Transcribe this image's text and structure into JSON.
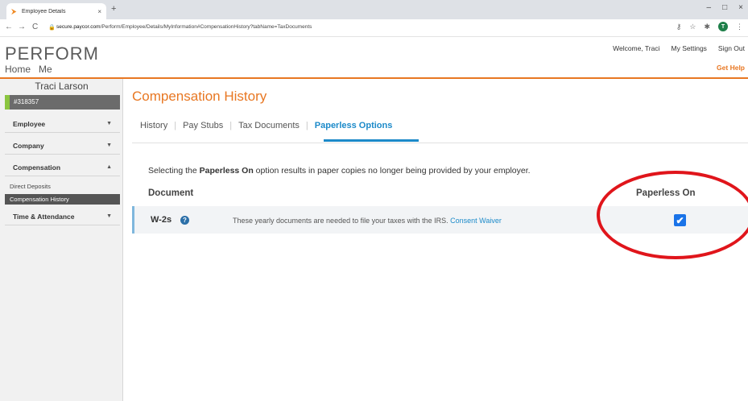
{
  "browser": {
    "tab_title": "Employee Details",
    "tab_close": "×",
    "new_tab": "+",
    "favicon": "⮞",
    "window_controls": [
      "–",
      "□",
      "×"
    ],
    "url_host": "secure.paycor.com",
    "url_path": "/Perform/Employee/Details/MyInformation#CompensationHistory?tabName=TaxDocuments",
    "profile_initial": "T"
  },
  "header": {
    "brand": "PERFORM",
    "nav": [
      "Home",
      "Me"
    ],
    "welcome": "Welcome, Traci",
    "my_settings": "My Settings",
    "sign_out": "Sign Out",
    "get_help": "Get Help",
    "accent_color": "#e87722"
  },
  "sidebar": {
    "employee_name": "Traci Larson",
    "employee_id": "#318357",
    "sections": [
      {
        "label": "Employee",
        "caret": "▼"
      },
      {
        "label": "Company",
        "caret": "▼"
      },
      {
        "label": "Compensation",
        "caret": "▲"
      },
      {
        "label": "Time & Attendance",
        "caret": "▼"
      }
    ],
    "sub_items": [
      "Direct Deposits",
      "Compensation History"
    ]
  },
  "main": {
    "title": "Compensation History",
    "tabs": [
      "History",
      "Pay Stubs",
      "Tax Documents",
      "Paperless Options"
    ],
    "active_tab": "Paperless Options",
    "intro_before": "Selecting the ",
    "intro_bold": "Paperless On",
    "intro_after": " option results in paper copies no longer being provided by your employer.",
    "col_document": "Document",
    "col_paperless": "Paperless On",
    "rows": [
      {
        "name": "W-2s",
        "help": "?",
        "description": "These yearly documents are needed to file your taxes with the IRS.",
        "link": "Consent Waiver",
        "paperless_checked": true,
        "check_glyph": "✔"
      }
    ]
  },
  "annotation": {
    "shape": "ellipse",
    "color": "#e0151b"
  }
}
